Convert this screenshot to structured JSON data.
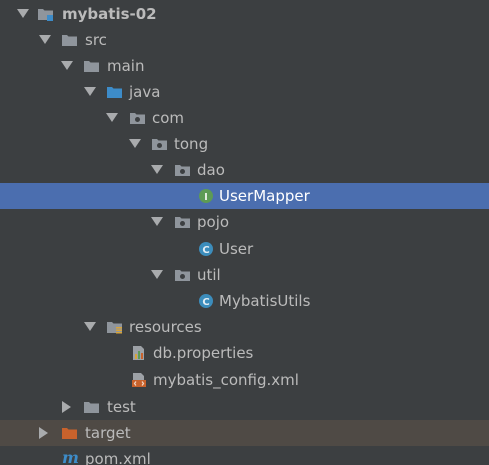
{
  "icons": {
    "module": "module-folder-icon",
    "folder": "folder-icon",
    "source_root": "source-root-folder-icon",
    "package": "package-icon",
    "interface": "interface-icon",
    "class": "class-icon",
    "resources": "resources-folder-icon",
    "properties": "properties-file-icon",
    "xml": "xml-file-icon",
    "excluded": "excluded-folder-icon",
    "maven": "maven-pom-icon"
  },
  "colors": {
    "background": "#3c3f41",
    "selection": "#4b6eaf",
    "excluded_row": "#4f4a45",
    "text": "#bbbbbb",
    "folder_gray": "#8f959c",
    "folder_blue": "#3d8cc9",
    "folder_orange": "#c8622c",
    "class_badge": "#3c8dbc",
    "interface_badge": "#5d9b55"
  },
  "tree": {
    "root": "mybatis-02",
    "src": "src",
    "main": "main",
    "java": "java",
    "com": "com",
    "tong": "tong",
    "dao": "dao",
    "user_mapper": "UserMapper",
    "pojo": "pojo",
    "user": "User",
    "util": "util",
    "mybatis_utils": "MybatisUtils",
    "resources": "resources",
    "db_properties": "db.properties",
    "mybatis_config": "mybatis_config.xml",
    "test": "test",
    "target": "target",
    "pom": "pom.xml"
  }
}
